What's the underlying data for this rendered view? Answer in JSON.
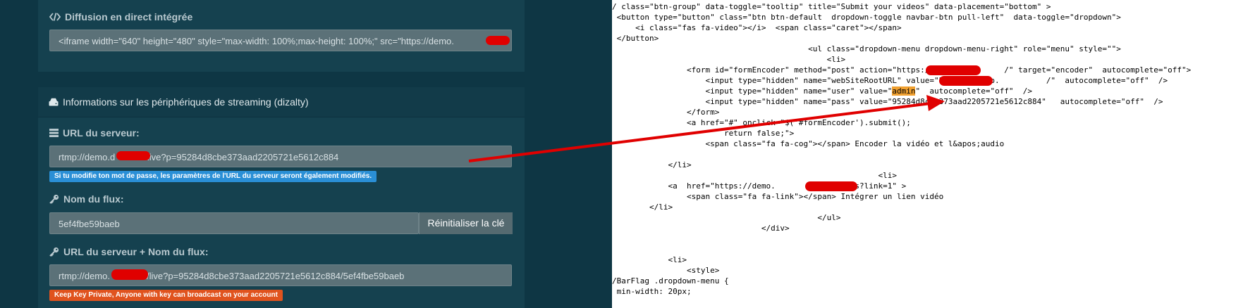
{
  "left": {
    "live_title": "Diffusion en direct intégrée",
    "embed_value": "<iframe width=\"640\" height=\"480\" style=\"max-width: 100%;max-height: 100%;\" src=\"https://demo.",
    "devices_title": "Informations sur les périphériques de streaming (dizalty)",
    "server_url_label": "URL du serveur:",
    "server_url_value_a": "rtmp://demo.d",
    "server_url_value_b": "/live?p=95284d8cbe373aad2205721e5612c884",
    "server_url_note": "Si tu modifie ton mot de passe, les paramètres de l'URL du serveur seront également modifiés.",
    "stream_name_label": "Nom du flux:",
    "stream_name_value": "5ef4fbe59baeb",
    "reset_key_button": "Réinitialiser la clé",
    "full_url_label": "URL du serveur + Nom du flux:",
    "full_url_value_a": "rtmp://demo.",
    "full_url_value_b": "/live?p=95284d8cbe373aad2205721e5612c884/5ef4fbe59baeb",
    "warning_badge": "Keep Key Private, Anyone with key can broadcast on your account",
    "colors": {
      "info_badge": "#2a8fd6",
      "warning_badge": "#e0531e",
      "redaction": "#e00000",
      "arrow": "#e00000"
    }
  },
  "code": {
    "lines": [
      "/ class=\"btn-group\" data-toggle=\"tooltip\" title=\"Submit your videos\" data-placement=\"bottom\" >",
      " <button type=\"button\" class=\"btn btn-default  dropdown-toggle navbar-btn pull-left\"  data-toggle=\"dropdown\">",
      "     <i class=\"fas fa-video\"></i>  <span class=\"caret\"></span>",
      " </button>",
      "                                          <ul class=\"dropdown-menu dropdown-menu-right\" role=\"menu\" style=\"\">",
      "                                              <li>",
      "                <form id=\"formEncoder\" method=\"post\" action=\"https://site.          /\" target=\"encoder\"  autocomplete=\"off\">",
      "                    <input type=\"hidden\" name=\"webSiteRootURL\" value=\"https://demo.          /\"  autocomplete=\"off\"  />",
      "                    <input type=\"hidden\" name=\"user\" value=\"",
      "                    <input type=\"hidden\" name=\"pass\" value=\"95284d8cbe373aad2205721e5612c884\"   autocomplete=\"off\"  />",
      "                </form>",
      "                <a href=\"#\" onclick=\"$('#formEncoder').submit();",
      "                        return false;\">",
      "                    <span class=\"fa fa-cog\"></span> Encoder la vidéo et l&apos;audio",
      "",
      "            </li>",
      "                                                         <li>",
      "            <a  href=\"https://demo.          /mvideos?link=1\" >",
      "                <span class=\"fa fa-link\"></span> Intégrer un lien vidéo",
      "        </li>",
      "                                            </ul>",
      "                                </div>",
      "",
      "",
      "            <li>",
      "                <style>",
      "/BarFlag .dropdown-menu {",
      " min-width: 20px;"
    ],
    "user_value": "admin",
    "user_rest": "\"  autocomplete=\"off\"  />"
  }
}
